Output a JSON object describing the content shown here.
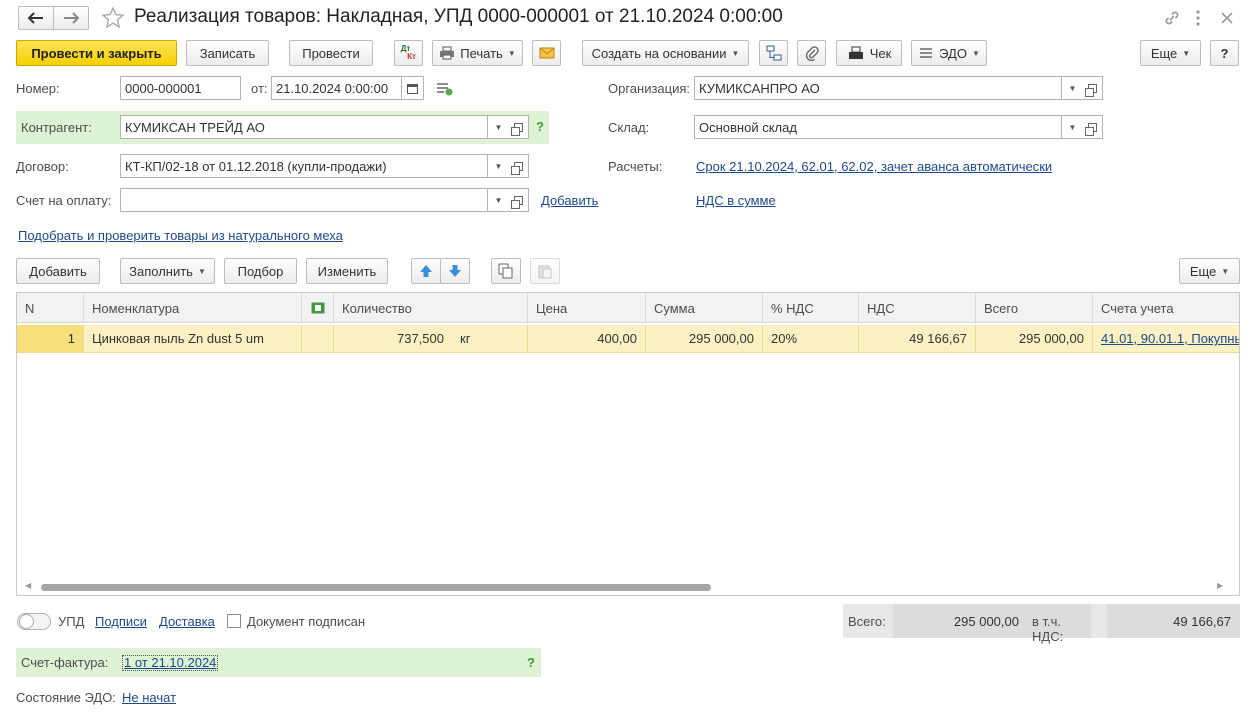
{
  "window": {
    "title": "Реализация товаров: Накладная, УПД 0000-000001 от 21.10.2024 0:00:00"
  },
  "toolbar": {
    "post_close": "Провести и закрыть",
    "save": "Записать",
    "post": "Провести",
    "dtkt_top": "Дт",
    "dtkt_bottom": "Кт",
    "print": "Печать",
    "create_based": "Создать на основании",
    "check": "Чек",
    "edo": "ЭДО",
    "more": "Еще",
    "help": "?"
  },
  "form": {
    "number_label": "Номер:",
    "number": "0000-000001",
    "date_label": "от:",
    "date": "21.10.2024  0:00:00",
    "org_label": "Организация:",
    "org": "КУМИКСАНПРО АО",
    "counterparty_label": "Контрагент:",
    "counterparty": "КУМИКСАН ТРЕЙД АО",
    "warehouse_label": "Склад:",
    "warehouse": "Основной склад",
    "contract_label": "Договор:",
    "contract": "КТ-КП/02-18 от 01.12.2018 (купли-продажи)",
    "settlements_label": "Расчеты:",
    "settlements": "Срок 21.10.2024, 62.01, 62.02, зачет аванса автоматически",
    "invoice_label": "Счет на оплату:",
    "invoice": "",
    "add_link": "Добавить",
    "vat_link": "НДС в сумме",
    "fur_link": "Подобрать и проверить товары из натурального меха",
    "help_q": "?"
  },
  "table_toolbar": {
    "add": "Добавить",
    "fill": "Заполнить",
    "pick": "Подбор",
    "change": "Изменить",
    "more": "Еще"
  },
  "table": {
    "headers": {
      "n": "N",
      "item": "Номенклатура",
      "qty": "Количество",
      "price": "Цена",
      "sum": "Сумма",
      "vat_rate": "% НДС",
      "vat": "НДС",
      "total": "Всего",
      "accounts": "Счета учета"
    },
    "rows": [
      {
        "n": "1",
        "item": "Цинковая пыль Zn dust 5 um",
        "qty": "737,500",
        "unit": "кг",
        "price": "400,00",
        "sum": "295 000,00",
        "vat_rate": "20%",
        "vat": "49 166,67",
        "total": "295 000,00",
        "accounts": "41.01, 90.01.1, Покупны"
      }
    ],
    "scroll_position": 0.0
  },
  "footer": {
    "upd_label": "УПД",
    "signatures": "Подписи",
    "delivery": "Доставка",
    "signed_label": "Документ подписан",
    "signed_checked": false,
    "total_label": "Всего:",
    "total": "295 000,00",
    "vat_label": "в т.ч. НДС:",
    "vat": "49 166,67",
    "sf_label": "Счет-фактура:",
    "sf_link": "1 от 21.10.2024",
    "sf_help": "?",
    "edo_label": "Состояние ЭДО:",
    "edo_state": "Не начат"
  },
  "colors": {
    "primary": "#f5d000",
    "row_selected": "#fbf1c3",
    "green_panel": "#def2d4",
    "link": "#1c4b8c",
    "arrow_blue": "#3a8fd9"
  }
}
